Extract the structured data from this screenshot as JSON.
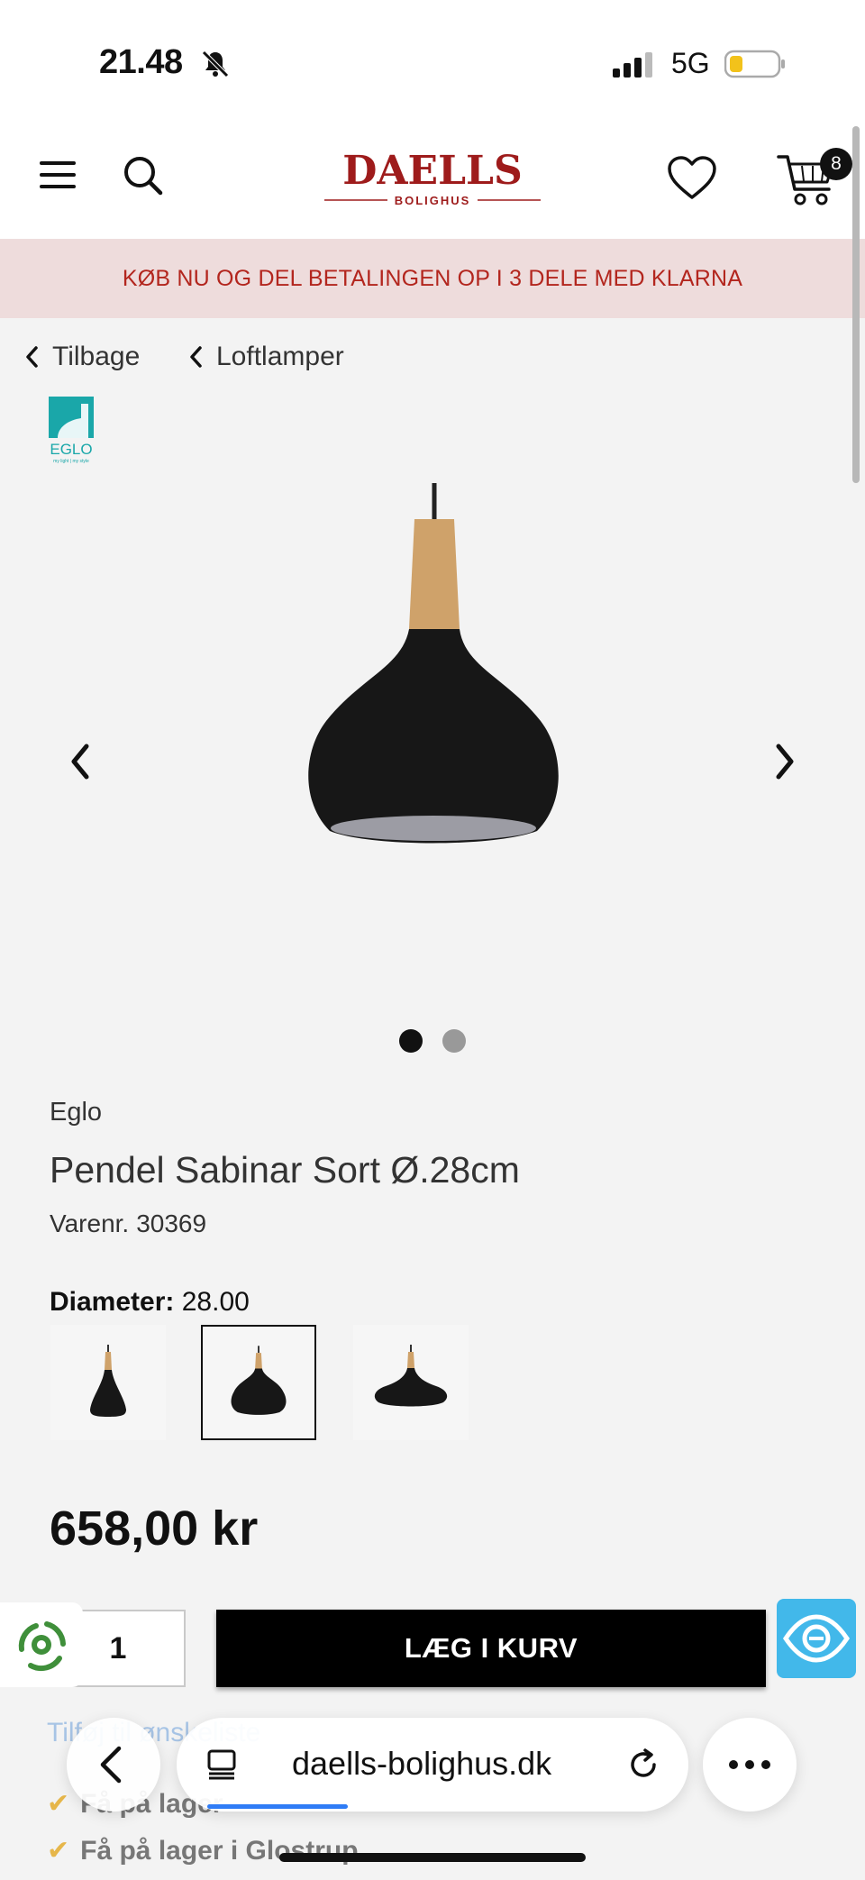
{
  "status_bar": {
    "time": "21.48",
    "network": "5G"
  },
  "header": {
    "logo_text": "DAELLS",
    "logo_sub": "BOLIGHUS",
    "cart_count": "8"
  },
  "promo": {
    "text": "KØB NU OG DEL BETALINGEN OP I 3 DELE MED KLARNA"
  },
  "breadcrumb": {
    "back_label": "Tilbage",
    "category_label": "Loftlamper"
  },
  "brand_logo": {
    "text": "EGLO",
    "tagline": "my light | my style"
  },
  "gallery": {
    "total_images": 2,
    "active_index": 1
  },
  "product": {
    "brand": "Eglo",
    "title": "Pendel Sabinar Sort Ø.28cm",
    "sku_label": "Varenr.",
    "sku": "30369",
    "option_label": "Diameter:",
    "option_value": "28.00",
    "variants_count": 3,
    "selected_variant": 2,
    "price": "658,00 kr"
  },
  "purchase": {
    "quantity": "1",
    "add_to_cart_label": "LÆG I KURV"
  },
  "below_fold": {
    "link_peek": "Tilføj til ønskeliste",
    "stock_1": "Få på lager",
    "stock_2": "Få på lager i Glostrup"
  },
  "browser": {
    "url": "daells-bolighus.dk"
  },
  "colors": {
    "accent_red": "#9e1b1b",
    "promo_bg": "#eedcdc",
    "widget_blue": "#42b8ea"
  }
}
